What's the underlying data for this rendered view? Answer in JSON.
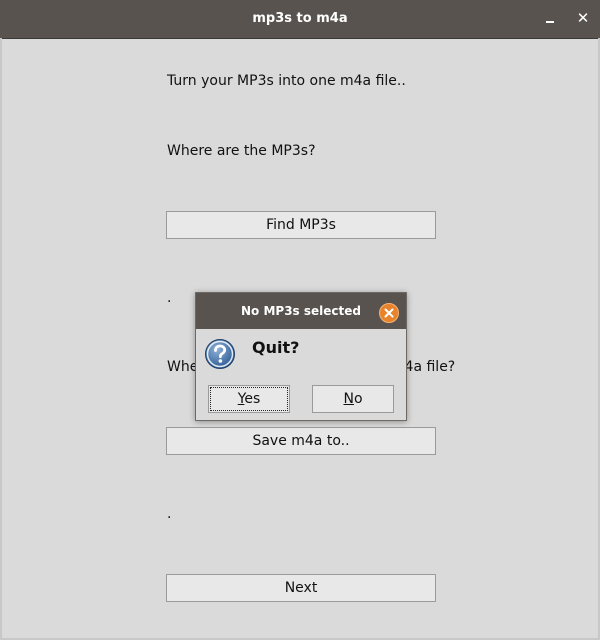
{
  "window": {
    "title": "mp3s to m4a",
    "minimize_glyph": "_",
    "close_glyph": "✕"
  },
  "main": {
    "intro": "Turn your MP3s into one m4a file..",
    "where_mp3s": "Where are the MP3s?",
    "find_button": "Find MP3s",
    "mp3s_path": ".",
    "where_save": "Where do you want to save the m4a file?",
    "save_button": "Save m4a to..",
    "save_path": ".",
    "next_button": "Next"
  },
  "dialog": {
    "title": "No MP3s selected",
    "message": "Quit?",
    "yes_mnemonic": "Y",
    "yes_rest": "es",
    "no_mnemonic": "N",
    "no_rest": "o",
    "icon": "question-icon",
    "accent_color": "#e8832c"
  }
}
